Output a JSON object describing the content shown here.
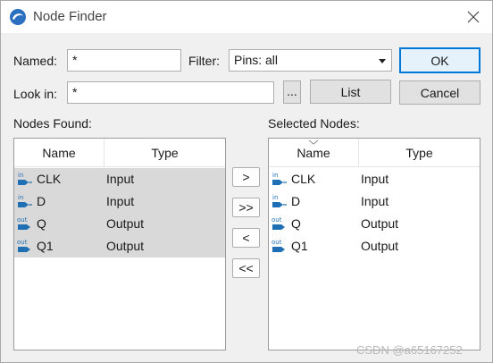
{
  "window": {
    "title": "Node Finder"
  },
  "form": {
    "named_label": "Named:",
    "named_value": "*",
    "filter_label": "Filter:",
    "filter_value": "Pins: all",
    "lookin_label": "Look in:",
    "lookin_value": "*",
    "browse_label": "...",
    "list_label": "List",
    "ok_label": "OK",
    "cancel_label": "Cancel"
  },
  "found": {
    "title": "Nodes Found:",
    "col_name": "Name",
    "col_type": "Type",
    "rows": [
      {
        "name": "CLK",
        "type": "Input",
        "dir": "in"
      },
      {
        "name": "D",
        "type": "Input",
        "dir": "in"
      },
      {
        "name": "Q",
        "type": "Output",
        "dir": "out"
      },
      {
        "name": "Q1",
        "type": "Output",
        "dir": "out"
      }
    ]
  },
  "selected": {
    "title": "Selected Nodes:",
    "col_name": "Name",
    "col_type": "Type",
    "rows": [
      {
        "name": "CLK",
        "type": "Input",
        "dir": "in"
      },
      {
        "name": "D",
        "type": "Input",
        "dir": "in"
      },
      {
        "name": "Q",
        "type": "Output",
        "dir": "out"
      },
      {
        "name": "Q1",
        "type": "Output",
        "dir": "out"
      }
    ]
  },
  "transfer": {
    "add_one": ">",
    "add_all": ">>",
    "remove_one": "<",
    "remove_all": "<<"
  },
  "watermark": "CSDN @a65167252",
  "colors": {
    "pin_blue": "#1f6fb5",
    "selection": "#d9d9d9",
    "default_border": "#0078d7"
  }
}
